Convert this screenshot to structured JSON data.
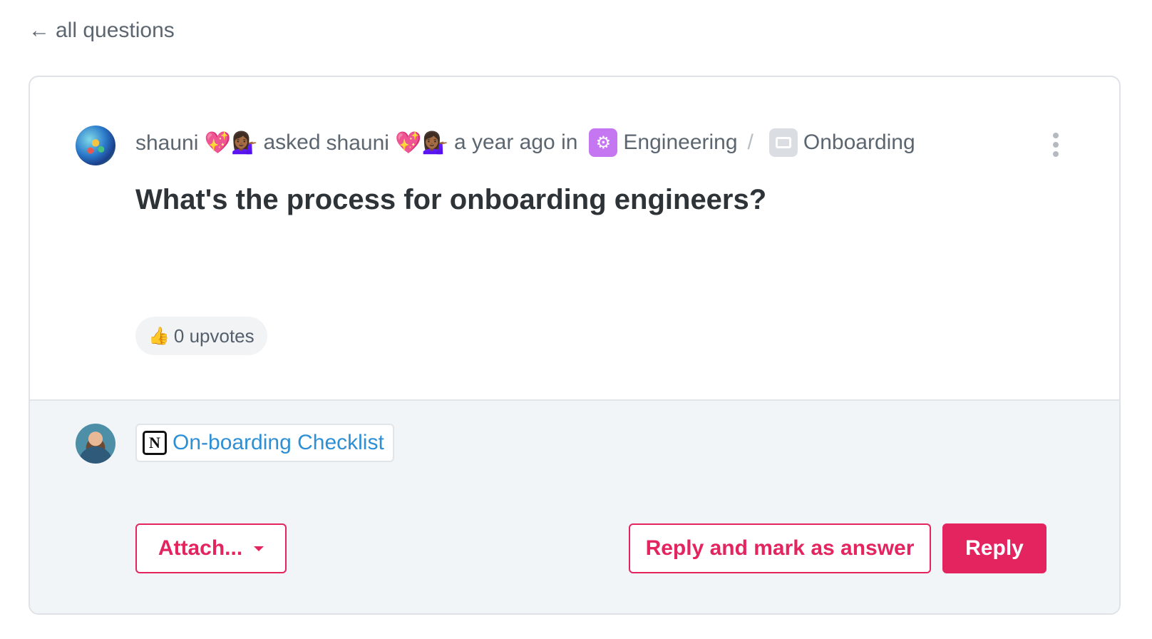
{
  "nav": {
    "back_label": "all questions"
  },
  "question": {
    "asker": "shauni 💖💁🏾‍♀️",
    "verb": "asked",
    "target": "shauni 💖💁🏾‍♀️",
    "time": "a year ago in",
    "channel": "Engineering",
    "separator": "/",
    "folder": "Onboarding",
    "title": "What's the process for onboarding engineers?",
    "upvotes_label": "0 upvotes",
    "upvote_count": 0
  },
  "reply": {
    "attachment_title": "On-boarding Checklist",
    "attachment_icon": "notion-icon",
    "attach_label": "Attach...",
    "mark_answer_label": "Reply and mark as answer",
    "reply_label": "Reply"
  },
  "colors": {
    "accent": "#e3245f",
    "link": "#2d8fd5",
    "channel_icon": "#c577f2"
  }
}
